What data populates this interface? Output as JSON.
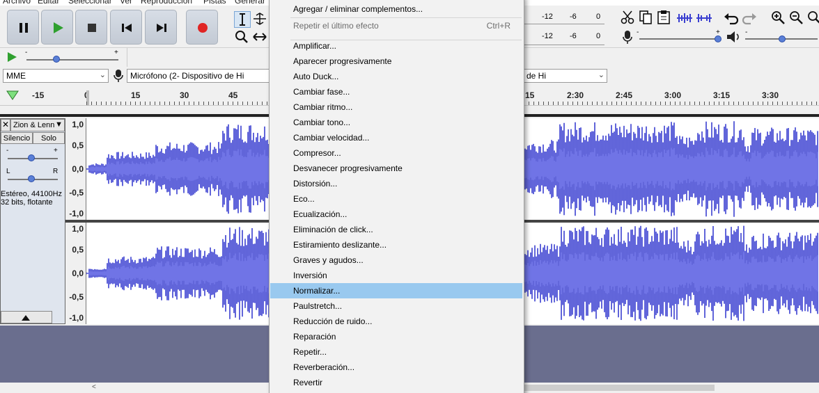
{
  "menubar": {
    "items": [
      "Archivo",
      "Editar",
      "Seleccionar",
      "Ver",
      "Reproducción",
      "Pistas",
      "Generar"
    ]
  },
  "meters": {
    "scale_top": [
      "-12",
      "-6",
      "0"
    ],
    "scale_bottom": [
      "-12",
      "-6",
      "0"
    ]
  },
  "speed": {
    "minus": "-",
    "plus": "+"
  },
  "mixer": {
    "minus": "-",
    "plus": "+"
  },
  "devices": {
    "host": "MME",
    "mic": "Micrófono (2- Dispositivo de Hi",
    "right_fragment": "de Hi"
  },
  "timeline": {
    "ticks_left": [
      "-15",
      "0",
      "15",
      "30",
      "45"
    ],
    "ticks_right": [
      "15",
      "2:30",
      "2:45",
      "3:00",
      "3:15",
      "3:30"
    ]
  },
  "track": {
    "name": "Zion & Lenn",
    "mute_label": "Silencio",
    "solo_label": "Solo",
    "gain_minus": "-",
    "gain_plus": "+",
    "pan_left": "L",
    "pan_right": "R",
    "info_line1": "Estéreo, 44100Hz",
    "info_line2": "32 bits, flotante",
    "ruler_top": [
      "1,0",
      "0,5",
      "0,0",
      "-0,5",
      "-1,0"
    ],
    "ruler_bottom": [
      "1,0",
      "0,5",
      "0,0",
      "-0,5",
      "-1,0"
    ]
  },
  "menu": {
    "items": [
      {
        "label": "Agregar / eliminar complementos...",
        "shortcut": "",
        "disabled": false,
        "highlight": false
      },
      {
        "label": "Repetir el último efecto",
        "shortcut": "Ctrl+R",
        "disabled": true,
        "highlight": false
      },
      {
        "label": "Amplificar...",
        "shortcut": "",
        "disabled": false,
        "highlight": false
      },
      {
        "label": "Aparecer progresivamente",
        "shortcut": "",
        "disabled": false,
        "highlight": false
      },
      {
        "label": "Auto Duck...",
        "shortcut": "",
        "disabled": false,
        "highlight": false
      },
      {
        "label": "Cambiar fase...",
        "shortcut": "",
        "disabled": false,
        "highlight": false
      },
      {
        "label": "Cambiar ritmo...",
        "shortcut": "",
        "disabled": false,
        "highlight": false
      },
      {
        "label": "Cambiar tono...",
        "shortcut": "",
        "disabled": false,
        "highlight": false
      },
      {
        "label": "Cambiar velocidad...",
        "shortcut": "",
        "disabled": false,
        "highlight": false
      },
      {
        "label": "Compresor...",
        "shortcut": "",
        "disabled": false,
        "highlight": false
      },
      {
        "label": "Desvanecer progresivamente",
        "shortcut": "",
        "disabled": false,
        "highlight": false
      },
      {
        "label": "Distorsión...",
        "shortcut": "",
        "disabled": false,
        "highlight": false
      },
      {
        "label": "Eco...",
        "shortcut": "",
        "disabled": false,
        "highlight": false
      },
      {
        "label": "Ecualización...",
        "shortcut": "",
        "disabled": false,
        "highlight": false
      },
      {
        "label": "Eliminación de click...",
        "shortcut": "",
        "disabled": false,
        "highlight": false
      },
      {
        "label": "Estiramiento deslizante...",
        "shortcut": "",
        "disabled": false,
        "highlight": false
      },
      {
        "label": "Graves y agudos...",
        "shortcut": "",
        "disabled": false,
        "highlight": false
      },
      {
        "label": "Inversión",
        "shortcut": "",
        "disabled": false,
        "highlight": false
      },
      {
        "label": "Normalizar...",
        "shortcut": "",
        "disabled": false,
        "highlight": true
      },
      {
        "label": "Paulstretch...",
        "shortcut": "",
        "disabled": false,
        "highlight": false
      },
      {
        "label": "Reducción de ruido...",
        "shortcut": "",
        "disabled": false,
        "highlight": false
      },
      {
        "label": "Reparación",
        "shortcut": "",
        "disabled": false,
        "highlight": false
      },
      {
        "label": "Repetir...",
        "shortcut": "",
        "disabled": false,
        "highlight": false
      },
      {
        "label": "Reverberación...",
        "shortcut": "",
        "disabled": false,
        "highlight": false
      },
      {
        "label": "Revertir",
        "shortcut": "",
        "disabled": false,
        "highlight": false
      }
    ]
  },
  "colors": {
    "wave_fill": "#3a3fd0",
    "wave_rms": "#6a6fe6",
    "menu_highlight": "#99c9ef",
    "record_red": "#e02424",
    "play_green": "#2fa02f"
  }
}
